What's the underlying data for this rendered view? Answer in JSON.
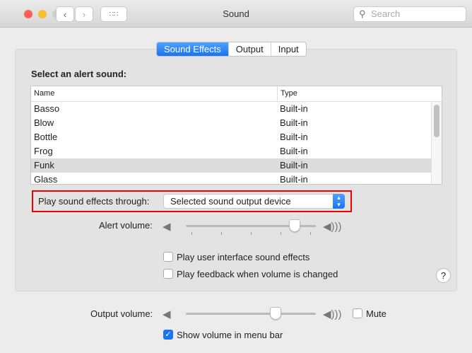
{
  "window": {
    "title": "Sound",
    "search_placeholder": "Search"
  },
  "tabs": [
    {
      "label": "Sound Effects",
      "active": true
    },
    {
      "label": "Output"
    },
    {
      "label": "Input"
    }
  ],
  "alert": {
    "heading": "Select an alert sound:",
    "columns": [
      "Name",
      "Type"
    ],
    "rows": [
      [
        "Basso",
        "Built-in"
      ],
      [
        "Blow",
        "Built-in"
      ],
      [
        "Bottle",
        "Built-in"
      ],
      [
        "Frog",
        "Built-in"
      ],
      [
        "Funk",
        "Built-in"
      ],
      [
        "Glass",
        "Built-in"
      ]
    ],
    "selected": "Funk"
  },
  "play_through": {
    "label": "Play sound effects through:",
    "value": "Selected sound output device"
  },
  "alert_volume": {
    "label": "Alert volume:",
    "level": 0.87
  },
  "checkboxes": {
    "ui_sounds": {
      "label": "Play user interface sound effects",
      "checked": false
    },
    "feedback": {
      "label": "Play feedback when volume is changed",
      "checked": false
    }
  },
  "help": "?",
  "output_volume": {
    "label": "Output volume:",
    "level": 0.71
  },
  "mute": {
    "label": "Mute",
    "checked": false
  },
  "show_volume": {
    "label": "Show volume in menu bar",
    "checked": true
  }
}
